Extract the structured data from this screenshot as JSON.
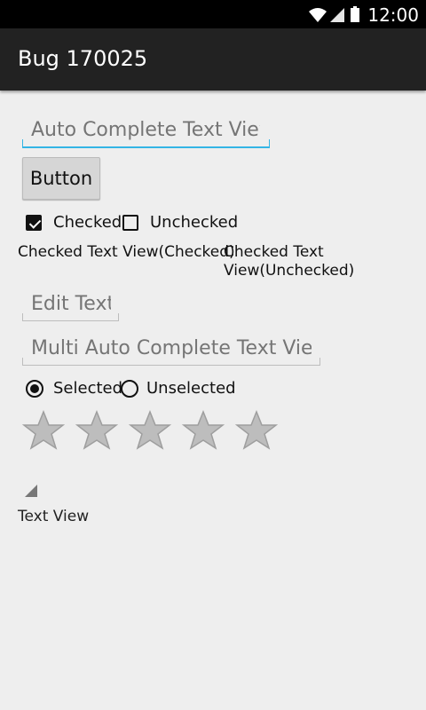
{
  "status_bar": {
    "time": "12:00"
  },
  "app": {
    "title": "Bug 170025"
  },
  "form": {
    "auto_complete": {
      "placeholder": "Auto Complete Text View",
      "value": ""
    },
    "button_label": "Button",
    "checkboxes": [
      {
        "label": "Checked",
        "checked": true
      },
      {
        "label": "Unchecked",
        "checked": false
      }
    ],
    "checked_text_views": [
      {
        "label": "Checked Text View(Checked)"
      },
      {
        "label_line1": "Checked Text",
        "label_line2": "View(Unchecked)"
      }
    ],
    "edit_text": {
      "placeholder": "Edit Text",
      "value": ""
    },
    "multi_auto_complete": {
      "placeholder": "Multi Auto Complete Text View",
      "value": ""
    },
    "radios": [
      {
        "label": "Selected",
        "selected": true
      },
      {
        "label": "Unselected",
        "selected": false
      }
    ],
    "rating_bar": {
      "rating": 0,
      "max": 5
    },
    "text_view": "Text View"
  },
  "colors": {
    "accent": "#33b5e5",
    "star_fill": "#bdbdbd",
    "star_stroke": "#9e9e9e"
  }
}
